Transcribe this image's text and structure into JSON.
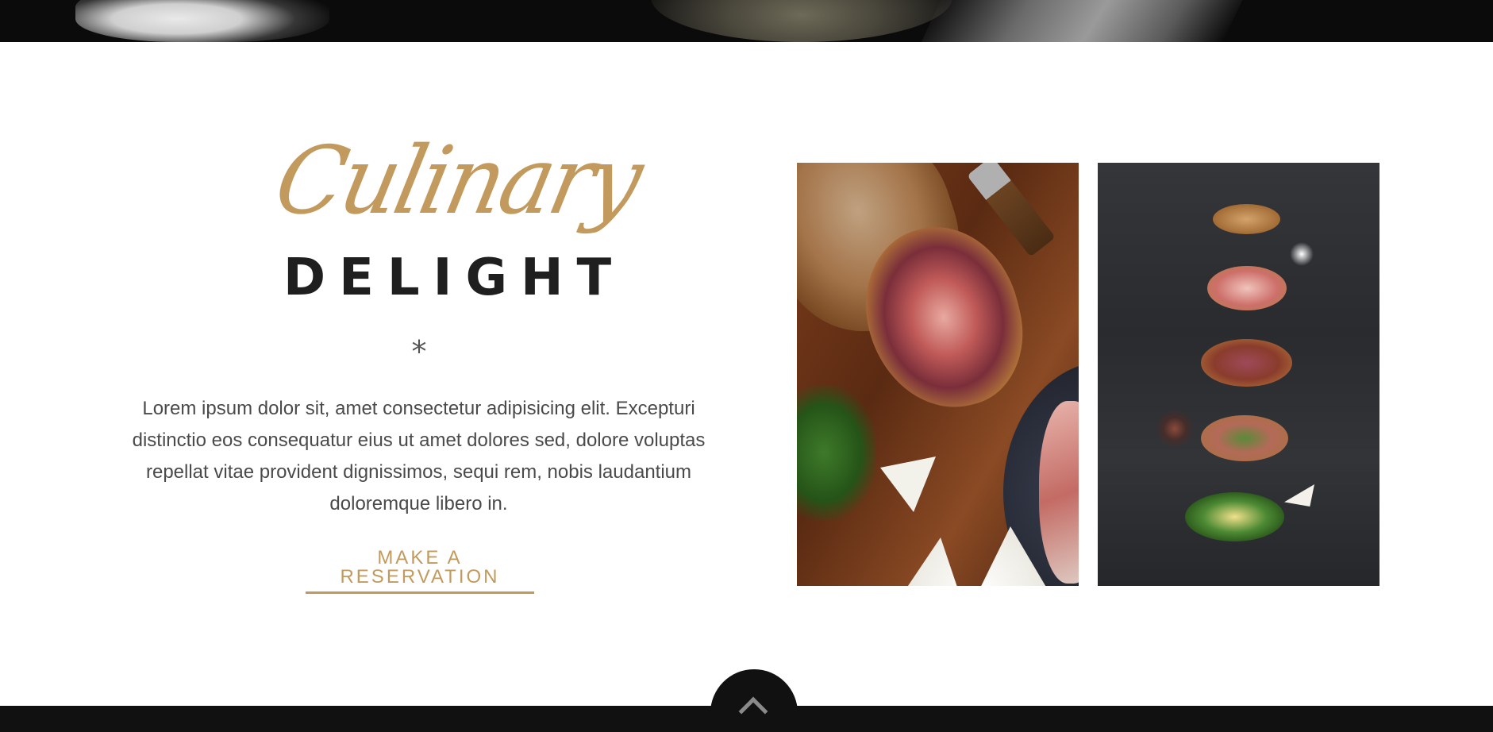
{
  "hero": {
    "script_title": "Culinary",
    "bold_title": "DELIGHT",
    "divider_glyph": "*",
    "description": "Lorem ipsum dolor sit, amet consectetur adipisicing elit. Excepturi distinctio eos consequatur eius ut amet dolores sed, dolore voluptas repellat vitae provident dignissimos, sequi rem, nobis laudantium doloremque libero in.",
    "cta_label": "MAKE A RESERVATION"
  },
  "colors": {
    "accent": "#c39a5d",
    "heading": "#1f1f1f",
    "body_text": "#4a4a4a",
    "footer_bg": "#111111"
  },
  "icons": {
    "back_to_top": "chevron-up-icon"
  }
}
